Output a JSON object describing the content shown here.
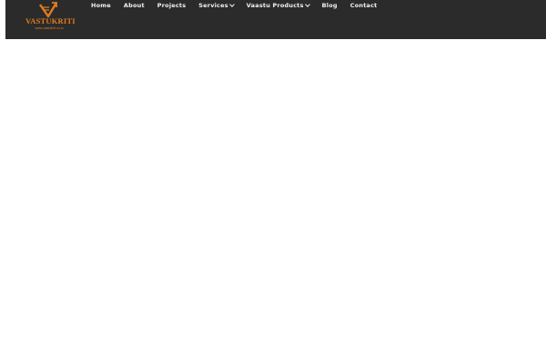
{
  "brand": {
    "name": "VASTUKRITI",
    "url": "www.vastukriti.co.in",
    "color": "#e07b1f"
  },
  "header": {
    "background": "#2b2b2b"
  },
  "nav": {
    "items": [
      {
        "label": "Home",
        "has_dropdown": false
      },
      {
        "label": "About",
        "has_dropdown": false
      },
      {
        "label": "Projects",
        "has_dropdown": false
      },
      {
        "label": "Services",
        "has_dropdown": true
      },
      {
        "label": "Vaastu Products",
        "has_dropdown": true
      },
      {
        "label": "Blog",
        "has_dropdown": false
      },
      {
        "label": "Contact",
        "has_dropdown": false
      }
    ]
  }
}
